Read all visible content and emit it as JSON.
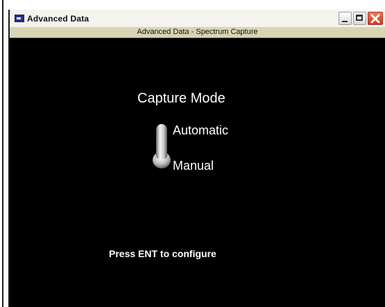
{
  "window": {
    "title": "Advanced Data",
    "icon": "app-window-icon"
  },
  "subtitle": "Advanced Data - Spectrum Capture",
  "capture_mode": {
    "title": "Capture Mode",
    "options": [
      "Automatic",
      "Manual"
    ],
    "selected": "Automatic"
  },
  "hint": "Press ENT to configure",
  "colors": {
    "background": "#000000",
    "subtitle_bar": "#d9d5b2",
    "close_button": "#d1361a"
  }
}
